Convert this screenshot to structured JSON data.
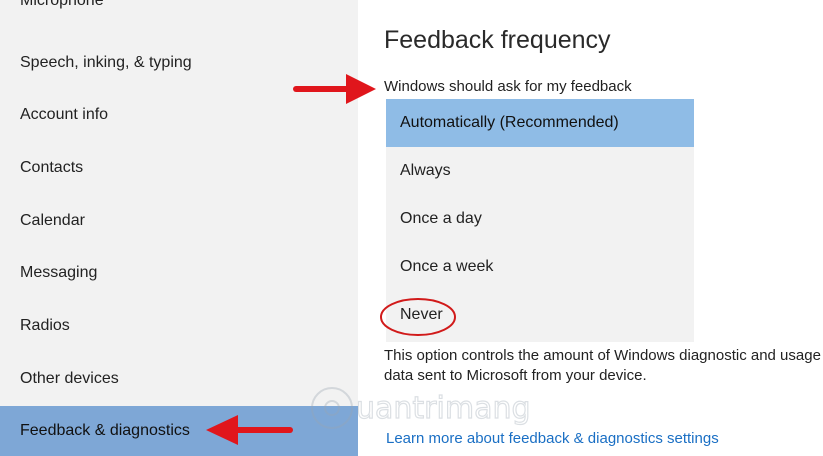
{
  "sidebar": {
    "items": [
      {
        "label": "Microphone"
      },
      {
        "label": "Speech, inking, & typing"
      },
      {
        "label": "Account info"
      },
      {
        "label": "Contacts"
      },
      {
        "label": "Calendar"
      },
      {
        "label": "Messaging"
      },
      {
        "label": "Radios"
      },
      {
        "label": "Other devices"
      },
      {
        "label": "Feedback & diagnostics"
      }
    ],
    "selected_color": "#7ea7d6"
  },
  "main": {
    "title": "Feedback frequency",
    "field_label": "Windows should ask for my feedback",
    "options": [
      {
        "label": "Automatically (Recommended)"
      },
      {
        "label": "Always"
      },
      {
        "label": "Once a day"
      },
      {
        "label": "Once a week"
      },
      {
        "label": "Never"
      }
    ],
    "selected_option": "Automatically (Recommended)",
    "description": "This option controls the amount of Windows diagnostic and usage data sent to Microsoft from your device.",
    "link_text": "Learn more about feedback & diagnostics settings",
    "watermark": "uantrimang"
  },
  "annotations": {
    "arrow_color": "#e0161c",
    "circle_color": "#d11a1a"
  }
}
